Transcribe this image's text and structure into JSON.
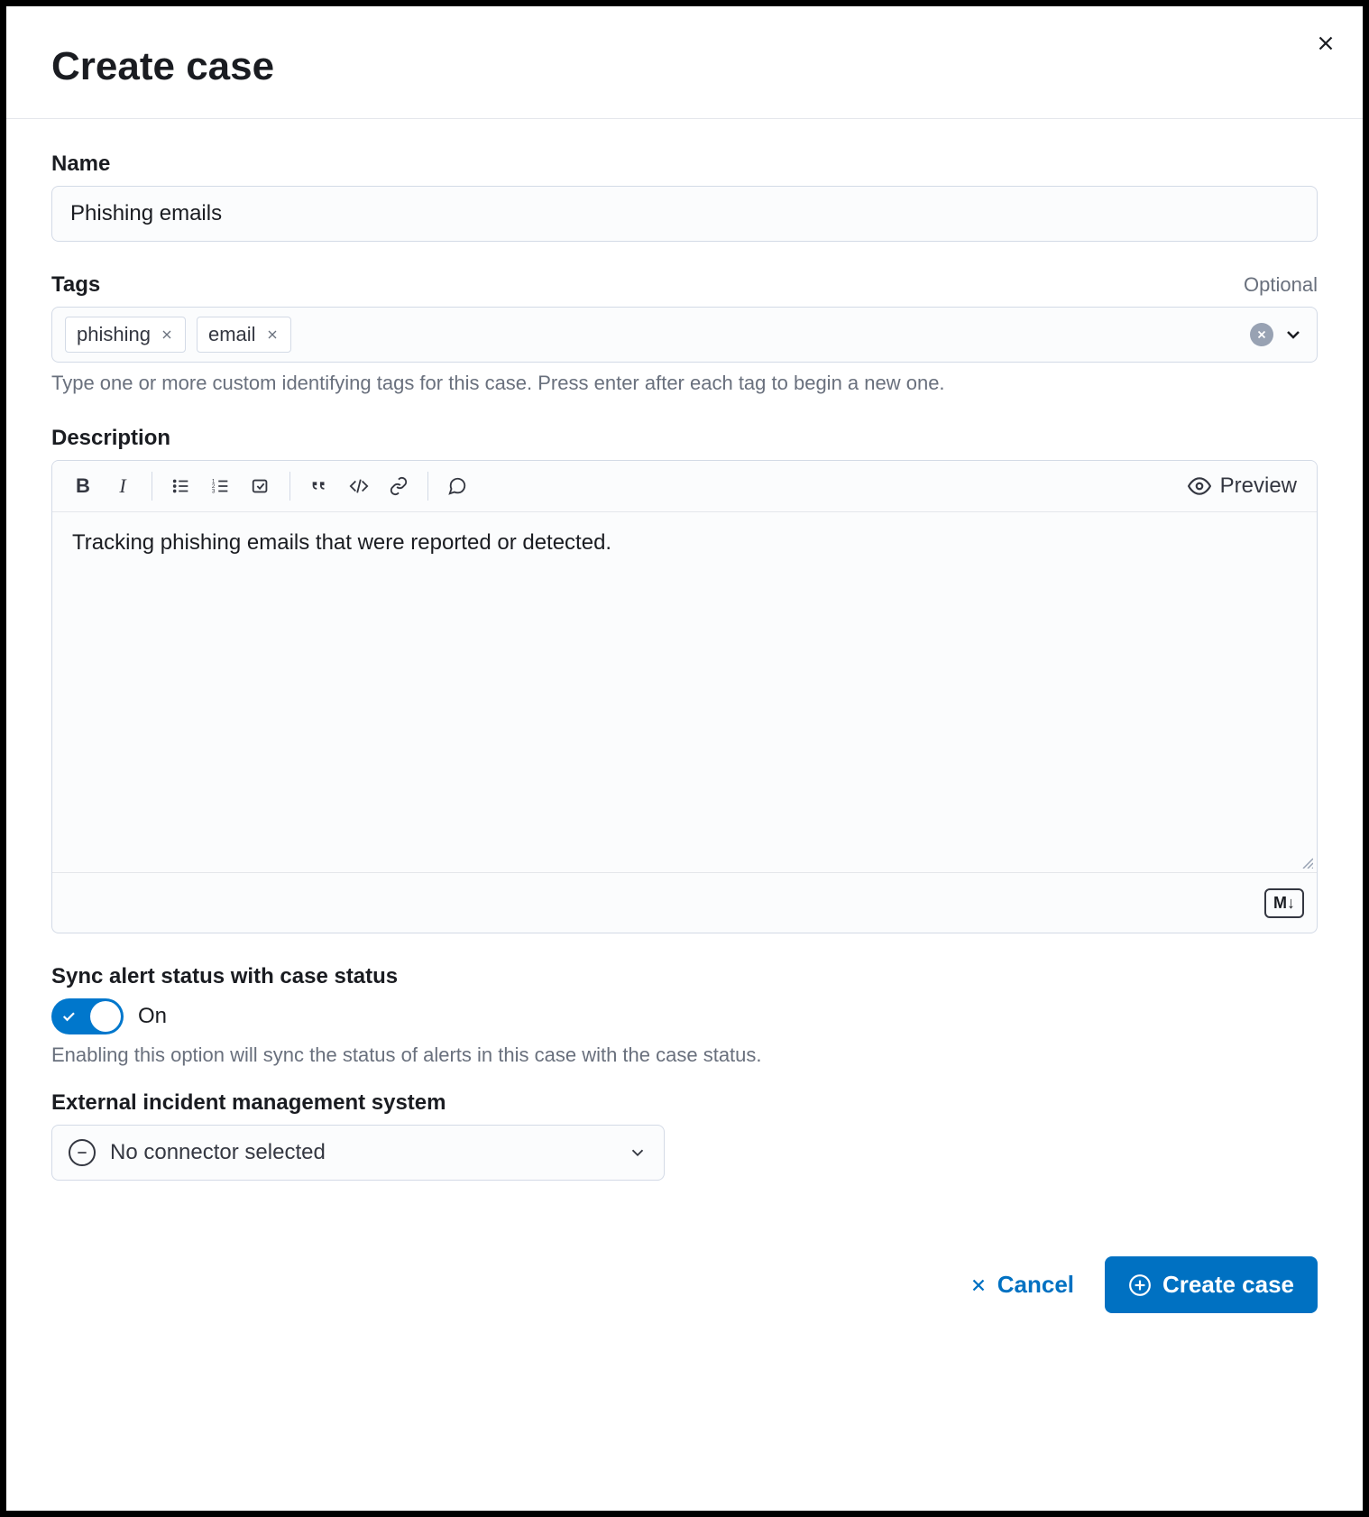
{
  "header": {
    "title": "Create case"
  },
  "name": {
    "label": "Name",
    "value": "Phishing emails"
  },
  "tags": {
    "label": "Tags",
    "optional": "Optional",
    "items": [
      "phishing",
      "email"
    ],
    "help": "Type one or more custom identifying tags for this case. Press enter after each tag to begin a new one."
  },
  "description": {
    "label": "Description",
    "value": "Tracking phishing emails that were reported or detected.",
    "preview_label": "Preview",
    "markdown_badge": "M↓"
  },
  "sync": {
    "label": "Sync alert status with case status",
    "state": "On",
    "help": "Enabling this option will sync the status of alerts in this case with the case status."
  },
  "connector": {
    "label": "External incident management system",
    "value": "No connector selected"
  },
  "actions": {
    "cancel": "Cancel",
    "create": "Create case"
  }
}
